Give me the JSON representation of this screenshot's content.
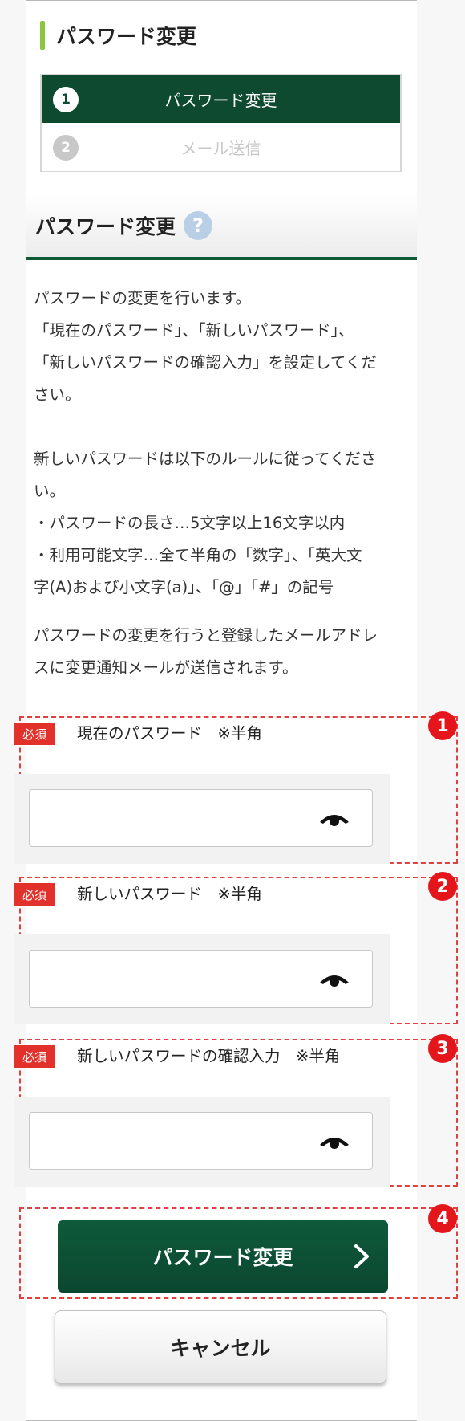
{
  "page_title": "パスワード変更",
  "steps": [
    {
      "num": "1",
      "label": "パスワード変更",
      "active": true
    },
    {
      "num": "2",
      "label": "メール送信",
      "active": false
    }
  ],
  "section": {
    "title": "パスワード変更",
    "help_icon": "?"
  },
  "description": {
    "p1": [
      "パスワードの変更を行います。",
      "「現在のパスワード」、「新しいパスワード」、",
      "「新しいパスワードの確認入力」を設定してくだ",
      "さい。"
    ],
    "p2": [
      "新しいパスワードは以下のルールに従ってくださ",
      "い。",
      "・パスワードの長さ…5文字以上16文字以内",
      "・利用可能文字…全て半角の「数字」、「英大文",
      "字(A)および小文字(a)」、「@」「#」の記号"
    ],
    "p3": [
      "パスワードの変更を行うと登録したメールアドレ",
      "スに変更通知メールが送信されます。"
    ]
  },
  "fields": [
    {
      "required": "必須",
      "label": "現在のパスワード　※半角",
      "value": "",
      "marker": "1"
    },
    {
      "required": "必須",
      "label": "新しいパスワード　※半角",
      "value": "",
      "marker": "2"
    },
    {
      "required": "必須",
      "label": "新しいパスワードの確認入力　※半角",
      "value": "",
      "marker": "3"
    }
  ],
  "submit": {
    "label": "パスワード変更",
    "marker": "4"
  },
  "cancel": {
    "label": "キャンセル"
  },
  "colors": {
    "primary": "#0e4a2f",
    "accent_bar": "#8cc63f",
    "required": "#e2312b",
    "marker": "#e5161b",
    "dashed": "#e04040"
  }
}
